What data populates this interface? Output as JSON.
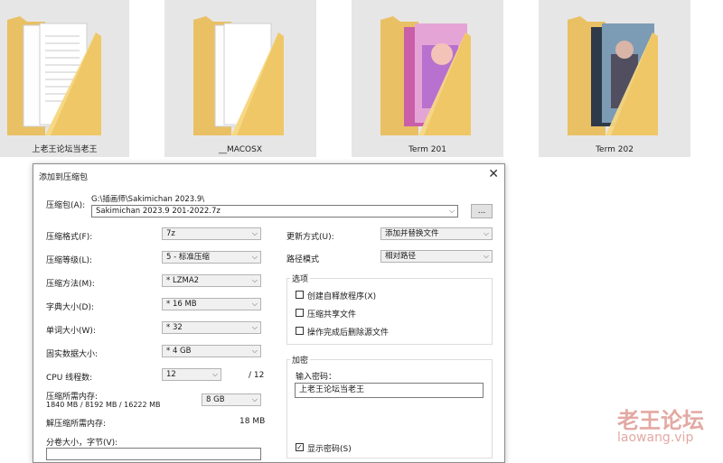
{
  "folders": [
    {
      "name": "上老王论坛当老王"
    },
    {
      "name": "__MACOSX"
    },
    {
      "name": "Term 201"
    },
    {
      "name": "Term 202"
    }
  ],
  "dialog": {
    "title": "添加到压缩包",
    "archive_label": "压缩包(A):",
    "archive_path": "G:\\插画师\\Sakimichan 2023.9\\",
    "archive_name": "Sakimichan 2023.9 201-2022.7z",
    "browse_label": "...",
    "left": {
      "format_label": "压缩格式(F):",
      "format_value": "7z",
      "level_label": "压缩等级(L):",
      "level_value": "5 - 标准压缩",
      "method_label": "压缩方法(M):",
      "method_value": "* LZMA2",
      "dict_label": "字典大小(D):",
      "dict_value": "* 16 MB",
      "word_label": "单词大小(W):",
      "word_value": "* 32",
      "solid_label": "固实数据大小:",
      "solid_value": "* 4 GB",
      "threads_label": "CPU 线程数:",
      "threads_value": "12",
      "threads_total": "/ 12",
      "mem_comp_label": "压缩所需内存:",
      "mem_comp_detail": "1840 MB / 8192 MB / 16222 MB",
      "mem_comp_value": "8 GB",
      "mem_decomp_label": "解压缩所需内存:",
      "mem_decomp_value": "18 MB",
      "split_label": "分卷大小，字节(V):"
    },
    "right": {
      "update_label": "更新方式(U):",
      "update_value": "添加并替换文件",
      "path_label": "路径模式",
      "path_value": "相对路径",
      "options_title": "选项",
      "opt_sfx": "创建自释放程序(X)",
      "opt_shared": "压缩共享文件",
      "opt_delete": "操作完成后删除源文件",
      "encrypt_title": "加密",
      "password_label": "输入密码：",
      "password_value": "上老王论坛当老王",
      "show_password": "显示密码(S)"
    }
  },
  "watermark": {
    "text": "老王论坛",
    "url": "laowang.vip"
  }
}
